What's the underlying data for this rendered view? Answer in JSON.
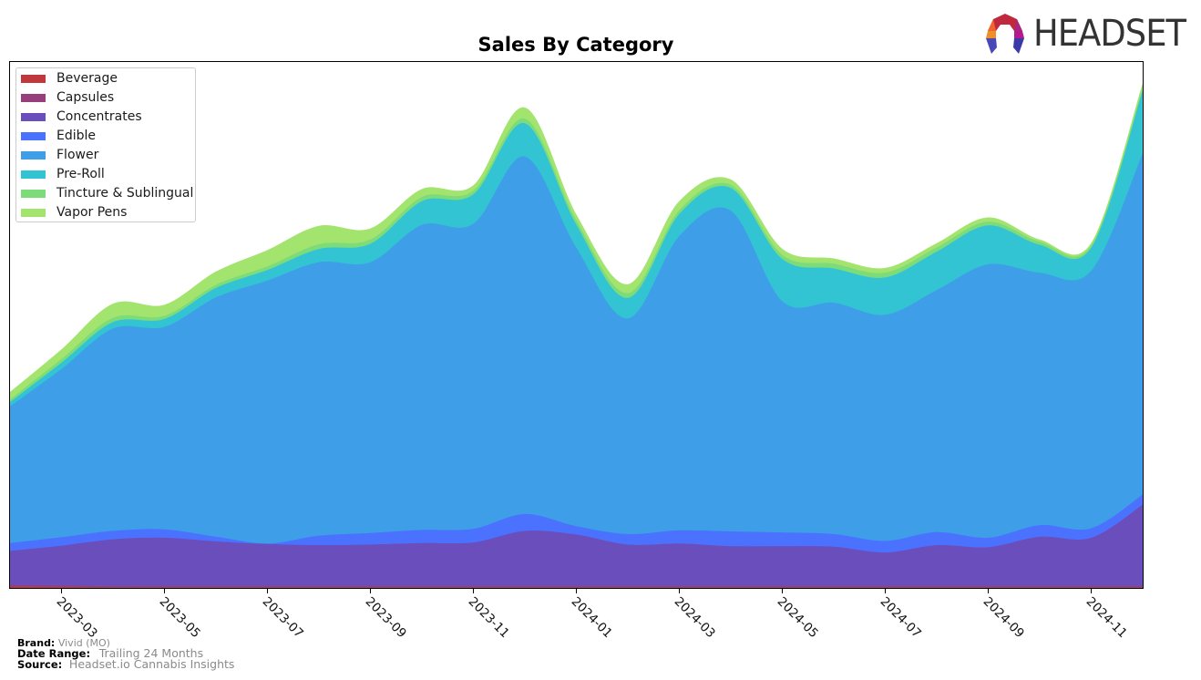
{
  "header": {
    "logo_text": "HEADSET"
  },
  "footer": {
    "brand_label": "Brand:",
    "brand_value": "Vivid (MO)",
    "date_range_label": "Date Range:",
    "date_range_value": "Trailing 24 Months",
    "source_label": "Source:",
    "source_value": "Headset.io Cannabis Insights"
  },
  "chart_data": {
    "type": "area",
    "stacked": true,
    "smoothed": true,
    "title": "Sales By Category",
    "xlabel": "",
    "ylabel": "",
    "y_axis_visible": false,
    "y_units": "relative share of plot height (0-100, no printed axis)",
    "ylim": [
      0,
      100
    ],
    "legend_position": "top-left",
    "grid": false,
    "x": [
      "2023-02",
      "2023-03",
      "2023-04",
      "2023-05",
      "2023-06",
      "2023-07",
      "2023-08",
      "2023-09",
      "2023-10",
      "2023-11",
      "2023-12",
      "2024-01",
      "2024-02",
      "2024-03",
      "2024-04",
      "2024-05",
      "2024-06",
      "2024-07",
      "2024-08",
      "2024-09",
      "2024-10",
      "2024-11",
      "2024-12"
    ],
    "tick_labels": [
      "2023-03",
      "2023-05",
      "2023-07",
      "2023-09",
      "2023-11",
      "2024-01",
      "2024-03",
      "2024-05",
      "2024-07",
      "2024-09",
      "2024-11"
    ],
    "series": [
      {
        "name": "Beverage",
        "color": "#c0383c",
        "values": [
          0.3,
          0.2,
          0.1,
          0.1,
          0.1,
          0.1,
          0.1,
          0.1,
          0.1,
          0.1,
          0.1,
          0.1,
          0.1,
          0.1,
          0.1,
          0.1,
          0.1,
          0.1,
          0.1,
          0.1,
          0.1,
          0.1,
          0.1
        ]
      },
      {
        "name": "Capsules",
        "color": "#963f7b",
        "values": [
          0.3,
          0.3,
          0.3,
          0.3,
          0.3,
          0.3,
          0.3,
          0.3,
          0.3,
          0.3,
          0.3,
          0.3,
          0.3,
          0.3,
          0.3,
          0.3,
          0.3,
          0.3,
          0.3,
          0.3,
          0.3,
          0.3,
          0.3
        ]
      },
      {
        "name": "Concentrates",
        "color": "#6a4fbc",
        "values": [
          6.5,
          7.6,
          8.9,
          9.2,
          8.5,
          8.0,
          7.8,
          7.9,
          8.2,
          8.3,
          10.5,
          9.8,
          7.9,
          8.1,
          7.6,
          7.6,
          7.5,
          6.4,
          7.8,
          7.4,
          9.4,
          9.2,
          15.5
        ]
      },
      {
        "name": "Edible",
        "color": "#4b72ff",
        "values": [
          1.5,
          1.6,
          1.6,
          1.6,
          0.9,
          0.1,
          1.8,
          2.2,
          2.5,
          2.6,
          3.2,
          1.6,
          2.0,
          2.5,
          2.8,
          2.6,
          2.4,
          2.2,
          2.5,
          1.8,
          2.2,
          1.8,
          1.9
        ]
      },
      {
        "name": "Flower",
        "color": "#3e9fe8",
        "values": [
          26,
          32,
          38.5,
          38.5,
          45.5,
          50,
          52,
          51.5,
          58,
          58,
          68,
          53,
          41,
          56,
          61,
          44,
          44,
          43,
          46,
          52,
          48,
          49,
          65
        ]
      },
      {
        "name": "Pre-Roll",
        "color": "#33c4d4",
        "values": [
          0.8,
          1.2,
          1.2,
          1.5,
          1.8,
          2.0,
          2.5,
          3.5,
          4.5,
          5.6,
          6.3,
          4.4,
          3.9,
          4.2,
          4.3,
          8.0,
          6.5,
          7.1,
          7.3,
          7.4,
          5.3,
          4.4,
          12.0
        ]
      },
      {
        "name": "Tincture & Sublingual",
        "color": "#7ddb7a",
        "values": [
          0.5,
          0.7,
          0.8,
          0.6,
          0.6,
          0.7,
          0.9,
          0.8,
          0.8,
          0.7,
          0.9,
          0.8,
          0.9,
          0.7,
          0.6,
          0.8,
          0.9,
          0.9,
          0.8,
          0.7,
          0.6,
          0.4,
          0.5
        ]
      },
      {
        "name": "Vapor Pens",
        "color": "#a3e46e",
        "values": [
          1.3,
          1.7,
          2.6,
          2.0,
          2.4,
          3.0,
          3.4,
          2.0,
          1.4,
          0.9,
          2.0,
          0.9,
          1.6,
          1.6,
          0.9,
          1.0,
          0.9,
          0.8,
          0.7,
          0.7,
          0.3,
          0.3,
          0.5
        ]
      }
    ]
  }
}
